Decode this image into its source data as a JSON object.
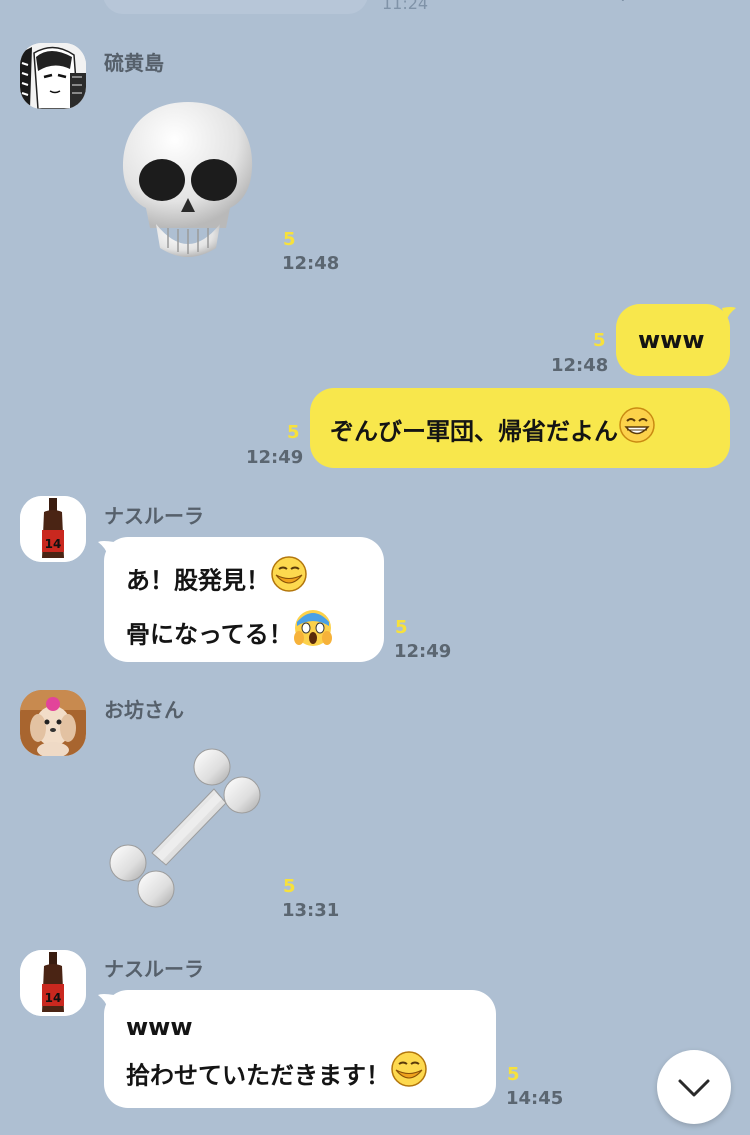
{
  "partial_header": {
    "time": "11:24"
  },
  "messages": [
    {
      "sender": "硫黄島",
      "read": "5",
      "time": "12:48",
      "sticker": "skull-sticker"
    },
    {
      "text": "www",
      "read": "5",
      "time": "12:48"
    },
    {
      "text": "ぞんびー軍団、帰省だよん",
      "emoji": "grinning-emoji",
      "read": "5",
      "time": "12:49"
    },
    {
      "sender": "ナスルーラ",
      "lines": [
        "あ！股発見！",
        "骨になってる！"
      ],
      "read": "5",
      "time": "12:49",
      "emoji": [
        "laughing-emoji",
        "screaming-emoji"
      ]
    },
    {
      "sender": "お坊さん",
      "read": "5",
      "time": "13:31",
      "sticker": "bone-sticker"
    },
    {
      "sender": "ナスルーラ",
      "lines": [
        "www",
        "拾わせていただきます！"
      ],
      "read": "5",
      "time": "14:45",
      "emoji": "laughing-emoji"
    }
  ],
  "bottle_label": "14",
  "scroll_down": {
    "icon": "chevron-down-icon"
  },
  "colors": {
    "background": "#aebfd2",
    "outgoing_bubble": "#f8e74c",
    "incoming_bubble": "#ffffff",
    "read_indicator": "#f7e13c"
  }
}
